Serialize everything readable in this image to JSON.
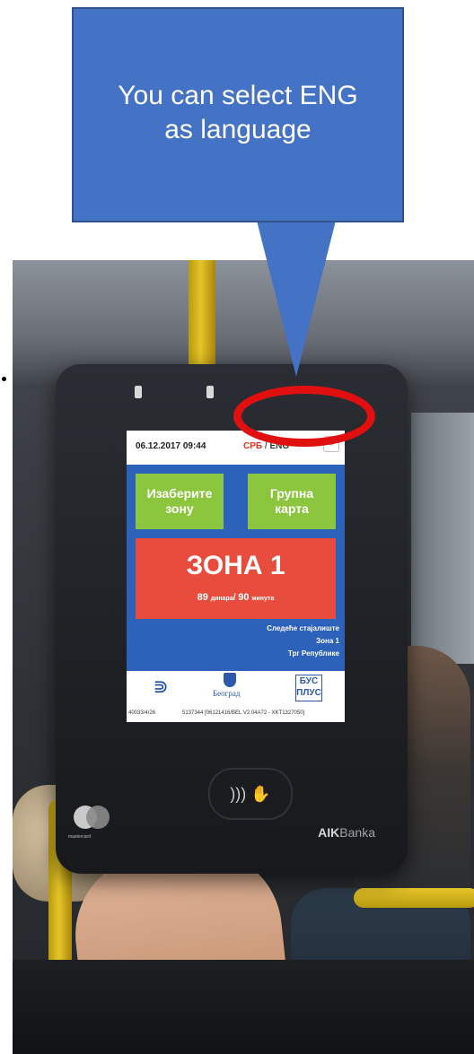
{
  "callout": {
    "text": "You can select ENG as language"
  },
  "screen": {
    "datetime": "06.12.2017 09:44",
    "lang_srb": "СРБ",
    "lang_separator": "/",
    "lang_eng": "ENG",
    "zone_select_label": "Изаберите\nзону",
    "group_ticket_label": "Групна\nкарта",
    "zone_title": "ЗОНА 1",
    "price_value": "89",
    "price_unit": "динара",
    "price_sep": "/",
    "duration_value": "90",
    "duration_unit": "минута",
    "next_stop_label": "Следеће стајалиште",
    "next_stop_zone": "Зона 1",
    "next_stop_name": "Трг Републике",
    "logo_city": "Београд",
    "logo_busplus": "БУС\nПЛУС",
    "footer_left": "40033/4/26",
    "footer_right": "5137344 [06121416/BEL V2.04A72 - XKT1327050]"
  },
  "device": {
    "contactless_symbol": "))) ✋",
    "mastercard_label": "mastercard",
    "bank_brand": "AIK",
    "bank_suffix": "Banka"
  },
  "colors": {
    "callout": "#4472c4",
    "highlight": "#e01010",
    "screen_blue": "#2d62ba",
    "zone_green": "#8cc63f",
    "zone_red": "#e74c3c"
  }
}
